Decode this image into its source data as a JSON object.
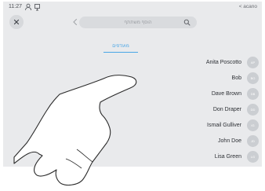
{
  "status_bar": {
    "time": "11:27",
    "right_label": "< acano"
  },
  "search": {
    "placeholder": "הוסף משתתף"
  },
  "tabs": [
    {
      "label": "מועדפים"
    }
  ],
  "contacts": [
    {
      "name": "Anita Poscotto",
      "initials": "AP"
    },
    {
      "name": "Bob",
      "initials": "BO"
    },
    {
      "name": "Dave Brown",
      "initials": "DB"
    },
    {
      "name": "Don Draper",
      "initials": "DD"
    },
    {
      "name": "Ismail Gulliver",
      "initials": "IG"
    },
    {
      "name": "John Doe",
      "initials": "JD"
    },
    {
      "name": "Lisa Green",
      "initials": "LG"
    }
  ]
}
